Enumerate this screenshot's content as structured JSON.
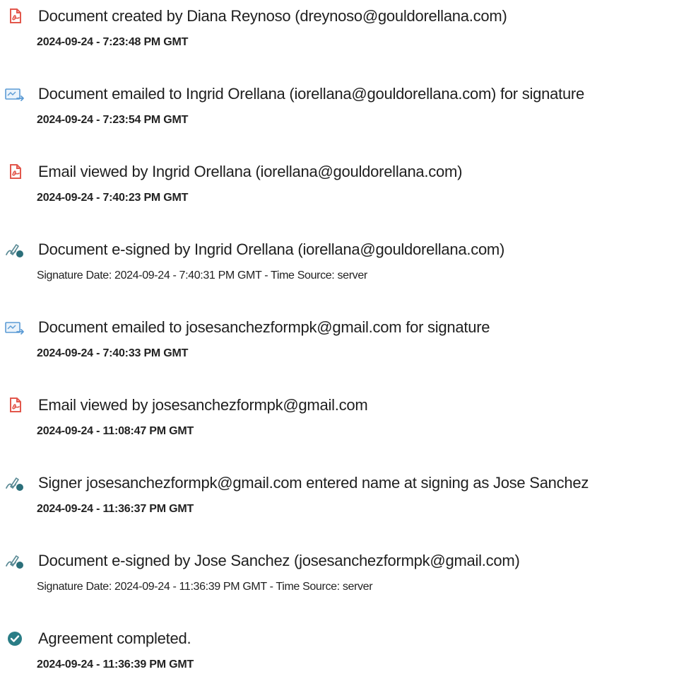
{
  "colors": {
    "pdf_icon": "#e2574c",
    "email_icon": "#5b9bd5",
    "sign_icon_pen": "#5a8a95",
    "sign_icon_dot": "#2b6f7a",
    "complete_icon": "#2a7d86",
    "text": "#1f1f1f"
  },
  "events": [
    {
      "icon": "pdf-document-icon",
      "title": "Document created by Diana Reynoso (dreynoso@gouldorellana.com)",
      "meta": "2024-09-24 - 7:23:48 PM GMT"
    },
    {
      "icon": "email-sent-icon",
      "title": "Document emailed to Ingrid Orellana (iorellana@gouldorellana.com) for signature",
      "meta": "2024-09-24 - 7:23:54 PM GMT"
    },
    {
      "icon": "pdf-document-icon",
      "title": "Email viewed by Ingrid Orellana (iorellana@gouldorellana.com)",
      "meta": "2024-09-24 - 7:40:23 PM GMT"
    },
    {
      "icon": "e-sign-icon",
      "title": "Document e-signed by Ingrid Orellana (iorellana@gouldorellana.com)",
      "meta": "Signature Date: 2024-09-24 - 7:40:31 PM GMT - Time Source: server"
    },
    {
      "icon": "email-sent-icon",
      "title": "Document emailed to josesanchezformpk@gmail.com for signature",
      "meta": "2024-09-24 - 7:40:33 PM GMT"
    },
    {
      "icon": "pdf-document-icon",
      "title": "Email viewed by josesanchezformpk@gmail.com",
      "meta": "2024-09-24 - 11:08:47 PM GMT"
    },
    {
      "icon": "e-sign-icon",
      "title": "Signer josesanchezformpk@gmail.com entered name at signing as Jose Sanchez",
      "meta": "2024-09-24 - 11:36:37 PM GMT"
    },
    {
      "icon": "e-sign-icon",
      "title": "Document e-signed by Jose Sanchez (josesanchezformpk@gmail.com)",
      "meta": "Signature Date: 2024-09-24 - 11:36:39 PM GMT - Time Source: server"
    },
    {
      "icon": "check-circle-icon",
      "title": "Agreement completed.",
      "meta": "2024-09-24 - 11:36:39 PM GMT"
    }
  ]
}
